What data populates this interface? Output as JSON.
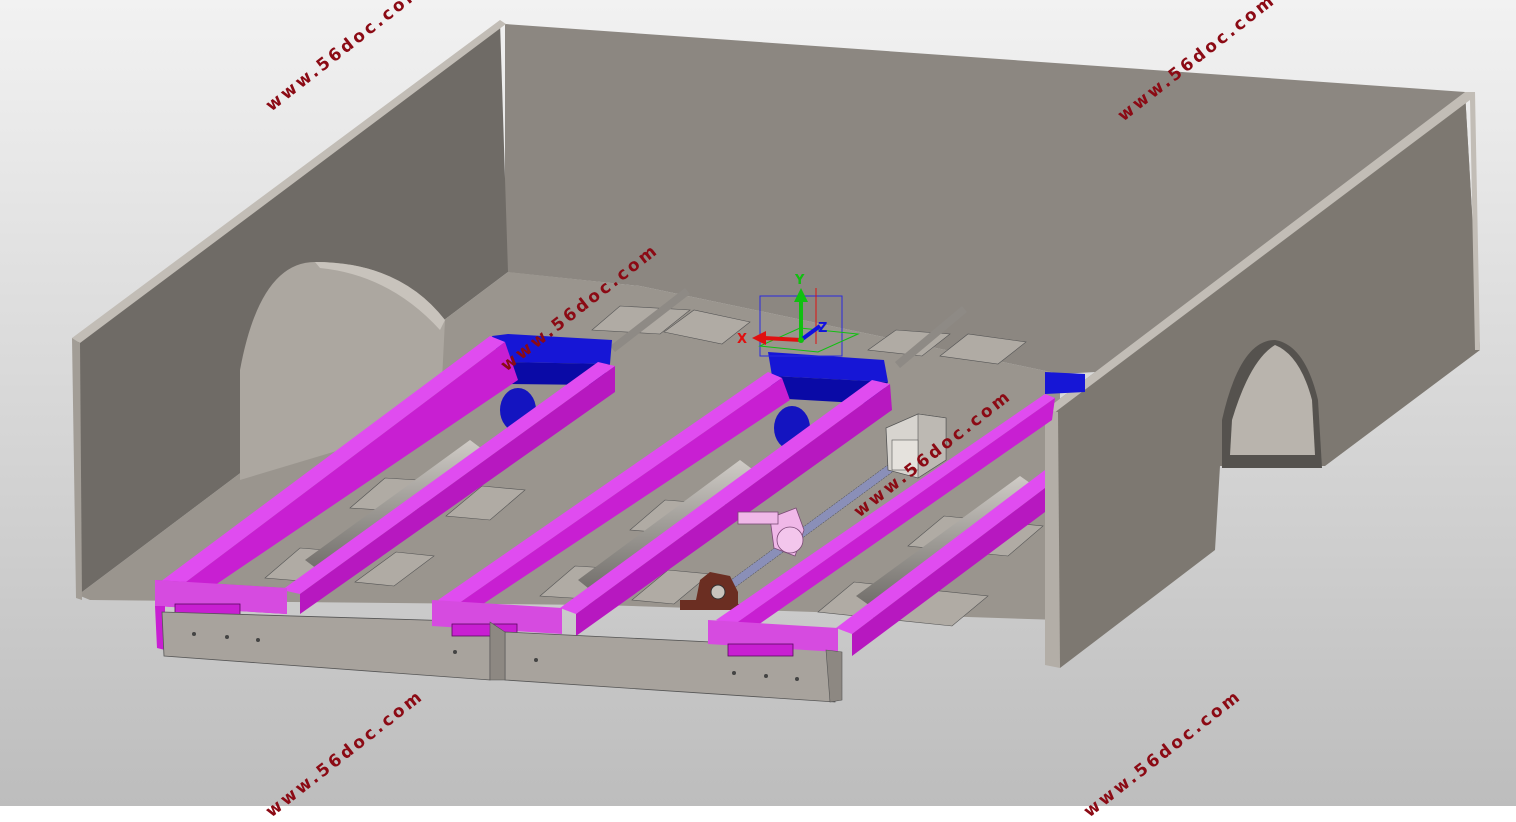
{
  "scene": {
    "background_top": "#f2f2f2",
    "background_bottom": "#bdbdbd",
    "colors": {
      "box_inner_back": "#8c8781",
      "box_inner_left": "#6f6b66",
      "box_floor": "#9a958e",
      "box_outer": "#7d7871",
      "box_rim": "#b3aea7",
      "magenta": "#c81fd2",
      "magenta_light": "#e04cf0",
      "blue": "#1616d6",
      "plate": "#a8a39d",
      "roller": "#9d9a95",
      "motor": "#d7d4cf",
      "pink": "#f0b8e8",
      "bearing_brown": "#6b2e22"
    }
  },
  "triad": {
    "x_label": "X",
    "y_label": "Y",
    "z_label": "Z",
    "x_color": "#e01010",
    "y_color": "#10c010",
    "z_color": "#1010e0"
  },
  "watermark": {
    "text": "www.56doc.com",
    "color": "#8b0a14"
  }
}
